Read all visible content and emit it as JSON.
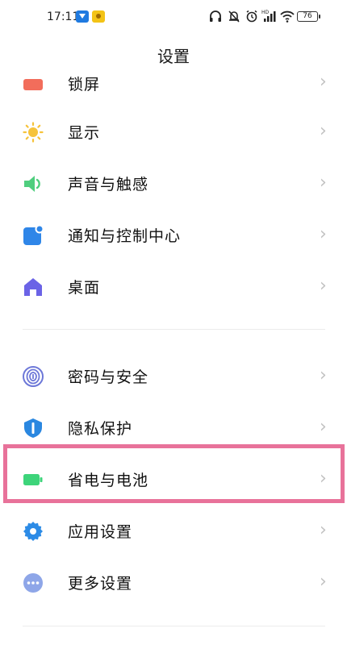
{
  "status_bar": {
    "time": "17:11",
    "icons": [
      "headphones-icon",
      "bell-off-icon",
      "alarm-icon",
      "hd-signal-icon",
      "wifi-icon"
    ],
    "battery": "76"
  },
  "header": {
    "title": "设置"
  },
  "items": [
    {
      "label": "锁屏",
      "icon": "lock-screen-icon"
    },
    {
      "label": "显示",
      "icon": "sun-icon"
    },
    {
      "label": "声音与触感",
      "icon": "speaker-icon"
    },
    {
      "label": "通知与控制中心",
      "icon": "notification-icon"
    },
    {
      "label": "桌面",
      "icon": "home-icon"
    },
    {
      "label": "密码与安全",
      "icon": "fingerprint-icon"
    },
    {
      "label": "隐私保护",
      "icon": "privacy-shield-icon"
    },
    {
      "label": "省电与电池",
      "icon": "battery-icon"
    },
    {
      "label": "应用设置",
      "icon": "gear-icon"
    },
    {
      "label": "更多设置",
      "icon": "more-icon"
    }
  ],
  "colors": {
    "highlight": "#e8729a",
    "lock": "#f26d5b",
    "display": "#f6c33a",
    "sound": "#4fce7e",
    "notification": "#2f86e8",
    "home": "#6b63e6",
    "security": "#6d78d8",
    "privacy": "#2a87e0",
    "battery": "#3dd47a",
    "apps": "#2c8be6",
    "more": "#8ea6e8"
  }
}
